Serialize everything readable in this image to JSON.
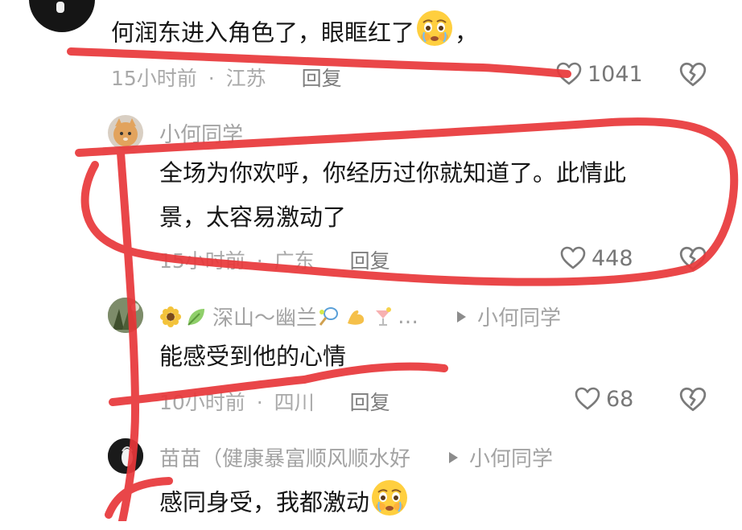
{
  "comments": [
    {
      "text": "何润东进入角色了，眼眶红了",
      "trailing": "，",
      "emoji": "crying-emoji",
      "time": "15小时前",
      "location": "江苏",
      "reply": "回复",
      "likes": "1041"
    },
    {
      "user": "小何同学",
      "text_line1": "全场为你欢呼，你经历过你就知道了。此情此",
      "text_line2": "景，太容易激动了",
      "time": "15小时前",
      "location": "广东",
      "reply": "回复",
      "likes": "448"
    },
    {
      "user": "深山～幽兰",
      "user_suffix": "…",
      "reply_to": "小何同学",
      "text": "能感受到他的心情",
      "time": "10小时前",
      "location": "四川",
      "reply": "回复",
      "likes": "68"
    },
    {
      "user": "苗苗（健康暴富顺风顺水好",
      "reply_to": "小何同学",
      "text": "感同身受，我都激动",
      "emoji": "crying-emoji"
    }
  ],
  "separator": "·",
  "colors": {
    "markup_red": "#e8373a",
    "meta_gray": "#a9a9a9",
    "text": "#161616"
  }
}
